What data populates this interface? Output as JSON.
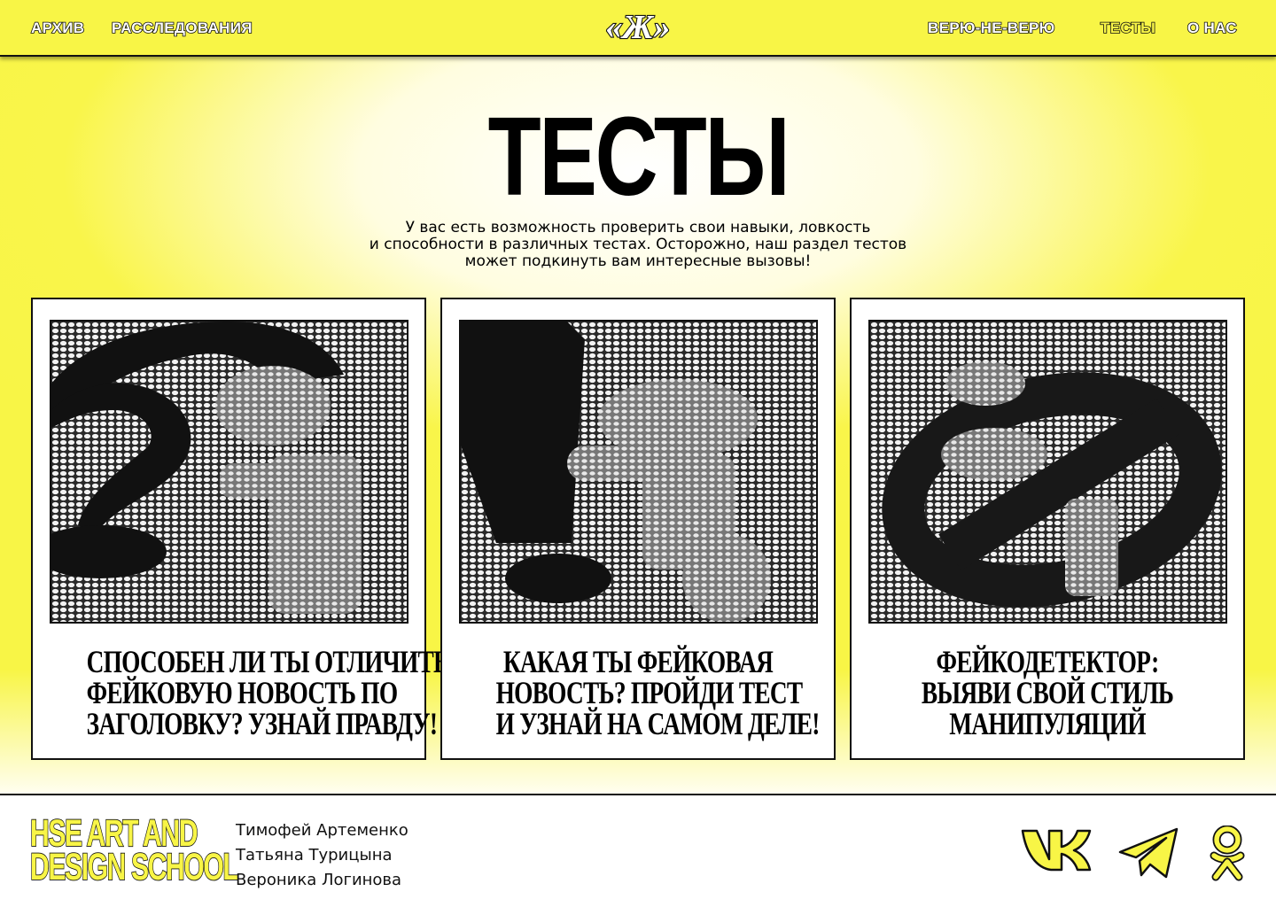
{
  "header": {
    "nav_left": [
      {
        "label": "АРХИВ"
      },
      {
        "label": "РАССЛЕДОВАНИЯ"
      }
    ],
    "logo_text": "«Ж»",
    "nav_right": [
      {
        "label": "ВЕРЮ-НЕ-ВЕРЮ"
      },
      {
        "label": "ТЕСТЫ",
        "active": true
      },
      {
        "label": "О НАС"
      }
    ]
  },
  "main": {
    "title": "ТЕСТЫ",
    "intro_lines": [
      "У вас есть возможность проверить свои навыки, ловкость",
      "и способности в различных тестах. Осторожно, наш раздел тестов",
      "может подкинуть вам интересные вызовы!"
    ],
    "cards": [
      {
        "image_icon": "question-mark-halftone-icon",
        "title_lines": [
          "СПОСОБЕН ЛИ ТЫ ОТЛИЧИТЬ",
          "ФЕЙКОВУЮ НОВОСТЬ ПО",
          "ЗАГОЛОВКУ? УЗНАЙ ПРАВДУ!"
        ]
      },
      {
        "image_icon": "exclamation-mark-halftone-icon",
        "title_lines": [
          "КАКАЯ ТЫ ФЕЙКОВАЯ",
          "НОВОСТЬ? ПРОЙДИ ТЕСТ",
          "И УЗНАЙ НА САМОМ ДЕЛЕ!"
        ]
      },
      {
        "image_icon": "prohibition-sign-halftone-icon",
        "title_lines": [
          "ФЕЙКОДЕТЕКТОР:",
          "ВЫЯВИ СВОЙ СТИЛЬ",
          "МАНИПУЛЯЦИЙ"
        ]
      }
    ]
  },
  "footer": {
    "school_lines": [
      "HSE ART AND",
      "DESIGN SCHOOL"
    ],
    "authors": [
      "Тимофей Артеменко",
      "Татьяна Турицына",
      "Вероника Логинова"
    ],
    "social": [
      "vk-icon",
      "telegram-icon",
      "odnoklassniki-icon"
    ]
  },
  "colors": {
    "accent_yellow": "#f8f546",
    "ink": "#111111"
  }
}
